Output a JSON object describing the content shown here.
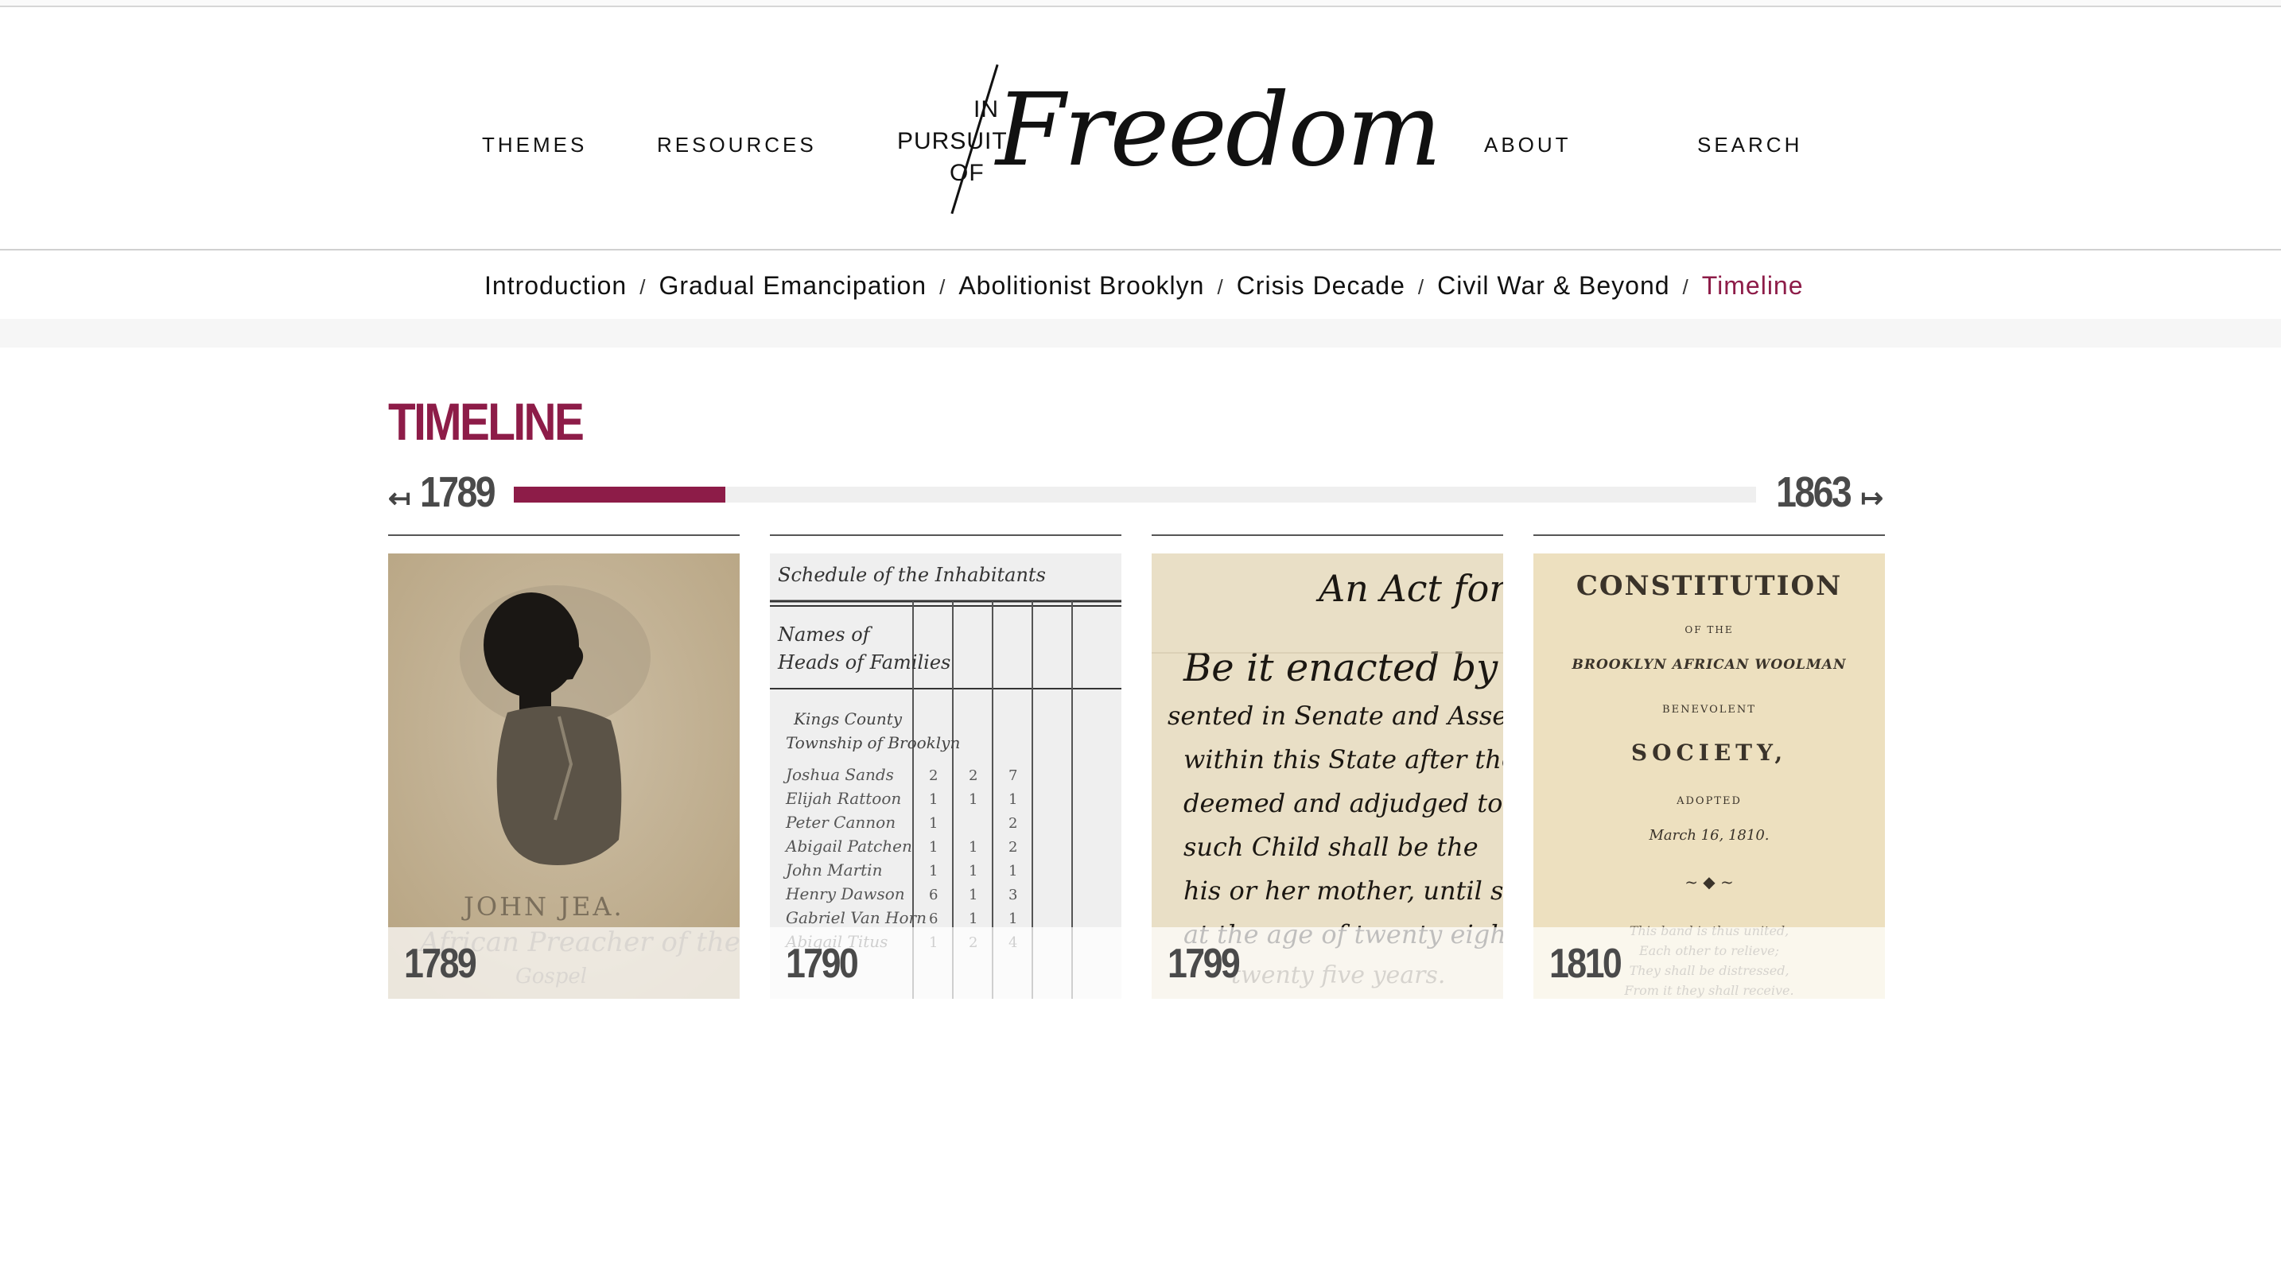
{
  "header": {
    "nav_left": [
      "THEMES",
      "RESOURCES"
    ],
    "nav_right": [
      "ABOUT",
      "SEARCH"
    ],
    "logo": {
      "small_lines": [
        "IN",
        "PURSUIT",
        "OF"
      ],
      "script": "Freedom"
    }
  },
  "breadcrumb": {
    "items": [
      "Introduction",
      "Gradual Emancipation",
      "Abolitionist Brooklyn",
      "Crisis Decade",
      "Civil War & Beyond",
      "Timeline"
    ],
    "separator": "/",
    "active_index": 5
  },
  "timeline": {
    "title": "TIMELINE",
    "start_year": "1789",
    "end_year": "1863",
    "progress_fraction": 0.17,
    "prev_arrow": "↤",
    "next_arrow": "↦",
    "cards": [
      {
        "year": "1789",
        "image": "portrait-silhouette-john-jea"
      },
      {
        "year": "1790",
        "image": "census-document"
      },
      {
        "year": "1799",
        "image": "handwritten-act"
      },
      {
        "year": "1810",
        "image": "printed-constitution-title-page"
      }
    ]
  },
  "colors": {
    "accent": "#8d1c48",
    "year_gray": "#4a4a4a",
    "track": "#efefef"
  }
}
